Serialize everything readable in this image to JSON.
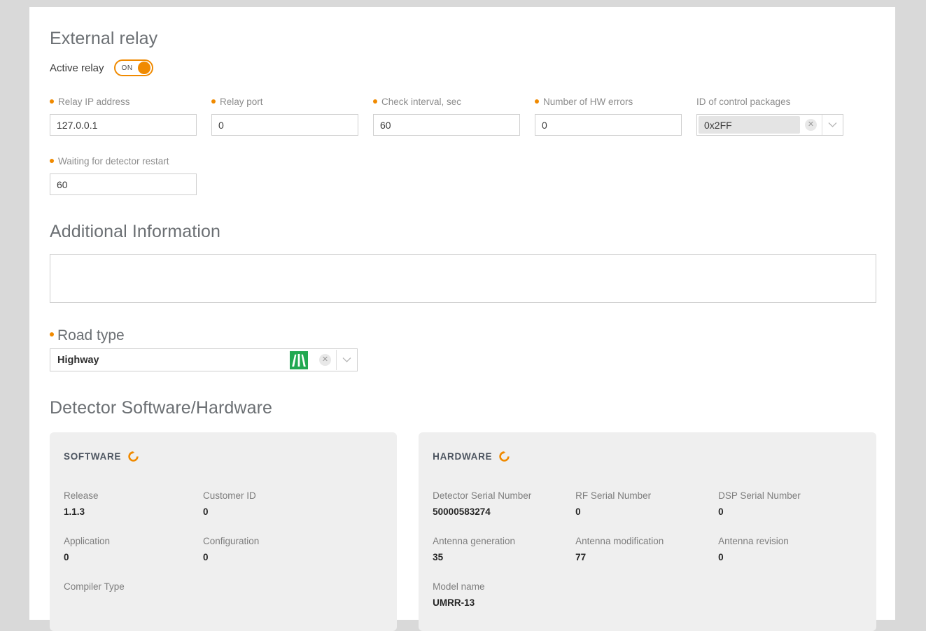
{
  "external_relay": {
    "title": "External relay",
    "toggle": {
      "label": "Active relay",
      "state_text": "ON"
    },
    "fields": [
      {
        "label": "Relay IP address",
        "value": "127.0.0.1",
        "required": true
      },
      {
        "label": "Relay port",
        "value": "0",
        "required": true
      },
      {
        "label": "Check interval, sec",
        "value": "60",
        "required": true
      },
      {
        "label": "Number of HW errors",
        "value": "0",
        "required": true
      }
    ],
    "control_packages": {
      "label": "ID of control packages",
      "value": "0x2FF",
      "clear_icon": "close-icon",
      "chevron_icon": "chevron-down-icon"
    },
    "restart_field": {
      "label": "Waiting for detector restart",
      "value": "60",
      "required": true
    }
  },
  "additional_information": {
    "title": "Additional Information",
    "value": "",
    "placeholder": ""
  },
  "road_type": {
    "label": "Road type",
    "value": "Highway",
    "icon": "highway-sign-icon",
    "icon_color": "#22a851",
    "clear_icon": "close-icon",
    "chevron_icon": "chevron-down-icon"
  },
  "detector": {
    "title": "Detector Software/Hardware",
    "software": {
      "heading": "SOFTWARE",
      "refresh_icon": "refresh-icon",
      "rows": [
        [
          {
            "label": "Release",
            "value": "1.1.3"
          },
          {
            "label": "Customer ID",
            "value": "0"
          }
        ],
        [
          {
            "label": "Application",
            "value": "0"
          },
          {
            "label": "Configuration",
            "value": "0"
          }
        ],
        [
          {
            "label": "Compiler Type",
            "value": ""
          }
        ]
      ]
    },
    "hardware": {
      "heading": "HARDWARE",
      "refresh_icon": "refresh-icon",
      "rows": [
        [
          {
            "label": "Detector Serial Number",
            "value": "50000583274"
          },
          {
            "label": "RF Serial Number",
            "value": "0"
          },
          {
            "label": "DSP Serial Number",
            "value": "0"
          }
        ],
        [
          {
            "label": "Antenna generation",
            "value": "35"
          },
          {
            "label": "Antenna modification",
            "value": "77"
          },
          {
            "label": "Antenna revision",
            "value": "0"
          }
        ],
        [
          {
            "label": "Model name",
            "value": "UMRR-13"
          }
        ]
      ]
    }
  },
  "colors": {
    "accent": "#f08a00",
    "panel": "#ffffff",
    "page_background": "#d9d9d9",
    "card_background": "#efefef"
  }
}
